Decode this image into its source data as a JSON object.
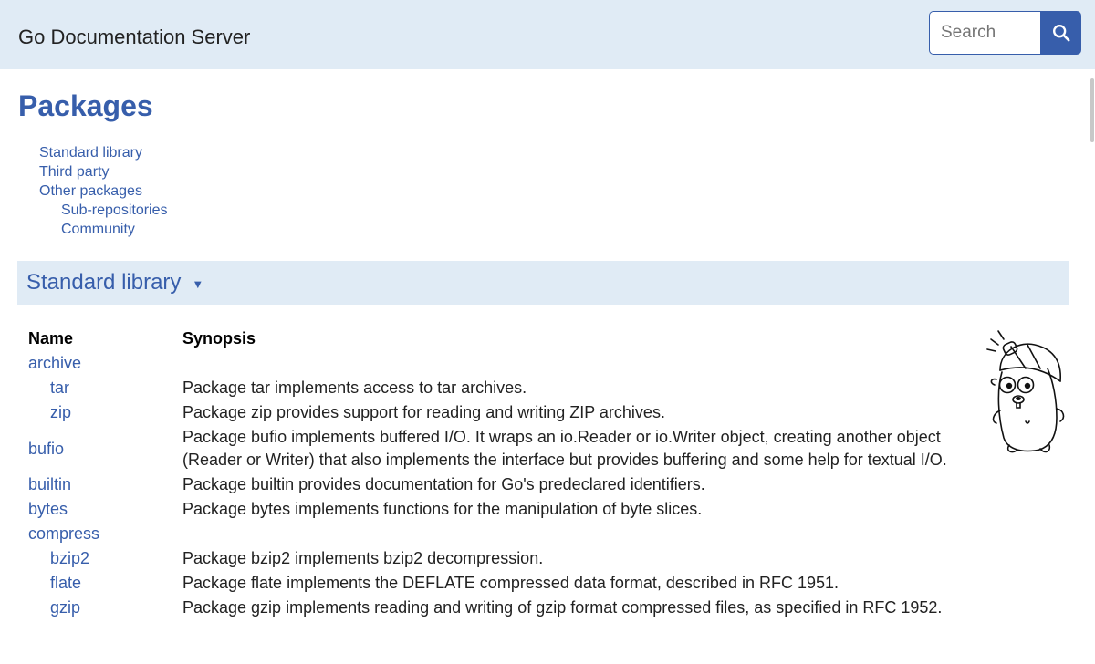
{
  "header": {
    "site_title": "Go Documentation Server",
    "search_placeholder": "Search",
    "search_button_icon": "search-icon"
  },
  "page": {
    "title": "Packages"
  },
  "toc": [
    {
      "label": "Standard library",
      "sub": false
    },
    {
      "label": "Third party",
      "sub": false
    },
    {
      "label": "Other packages",
      "sub": false
    },
    {
      "label": "Sub-repositories",
      "sub": true
    },
    {
      "label": "Community",
      "sub": true
    }
  ],
  "section": {
    "title": "Standard library",
    "toggle_icon": "caret-down-icon"
  },
  "table": {
    "headers": {
      "name": "Name",
      "synopsis": "Synopsis"
    },
    "rows": [
      {
        "name": "archive",
        "indent": false,
        "synopsis": ""
      },
      {
        "name": "tar",
        "indent": true,
        "synopsis": "Package tar implements access to tar archives."
      },
      {
        "name": "zip",
        "indent": true,
        "synopsis": "Package zip provides support for reading and writing ZIP archives."
      },
      {
        "name": "bufio",
        "indent": false,
        "synopsis": "Package bufio implements buffered I/O. It wraps an io.Reader or io.Writer object, creating another object (Reader or Writer) that also implements the interface but provides buffering and some help for textual I/O."
      },
      {
        "name": "builtin",
        "indent": false,
        "synopsis": "Package builtin provides documentation for Go's predeclared identifiers."
      },
      {
        "name": "bytes",
        "indent": false,
        "synopsis": "Package bytes implements functions for the manipulation of byte slices."
      },
      {
        "name": "compress",
        "indent": false,
        "synopsis": ""
      },
      {
        "name": "bzip2",
        "indent": true,
        "synopsis": "Package bzip2 implements bzip2 decompression."
      },
      {
        "name": "flate",
        "indent": true,
        "synopsis": "Package flate implements the DEFLATE compressed data format, described in RFC 1951."
      },
      {
        "name": "gzip",
        "indent": true,
        "synopsis": "Package gzip implements reading and writing of gzip format compressed files, as specified in RFC 1952."
      }
    ]
  },
  "colors": {
    "accent": "#375eab",
    "header_bg": "#e0ebf5"
  }
}
